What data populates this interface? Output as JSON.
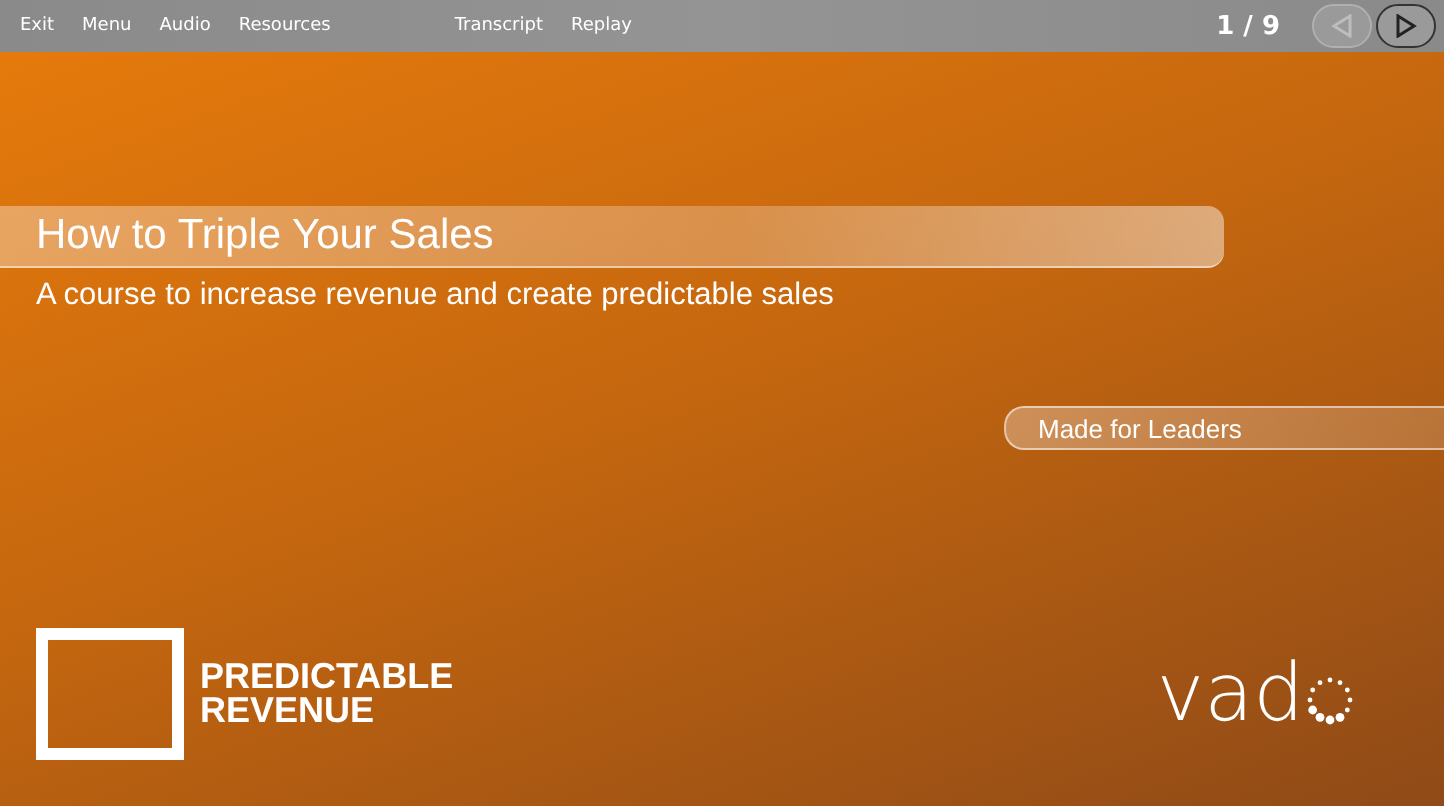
{
  "toolbar": {
    "left_menu": [
      {
        "label": "Exit"
      },
      {
        "label": "Menu"
      },
      {
        "label": "Audio"
      },
      {
        "label": "Resources"
      }
    ],
    "right_menu": [
      {
        "label": "Transcript"
      },
      {
        "label": "Replay"
      }
    ],
    "page_counter": "1 / 9",
    "nav": [
      {
        "kind": "prev",
        "disabled": true
      },
      {
        "kind": "next",
        "disabled": false
      }
    ]
  },
  "slide": {
    "title": "How to Triple Your Sales",
    "subtitle": "A course to increase revenue and create predictable sales",
    "tag": "Made for Leaders",
    "brand": {
      "lines": [
        "PREDICTABLE",
        "REVENUE"
      ]
    },
    "logo": {
      "text": "vad"
    }
  }
}
